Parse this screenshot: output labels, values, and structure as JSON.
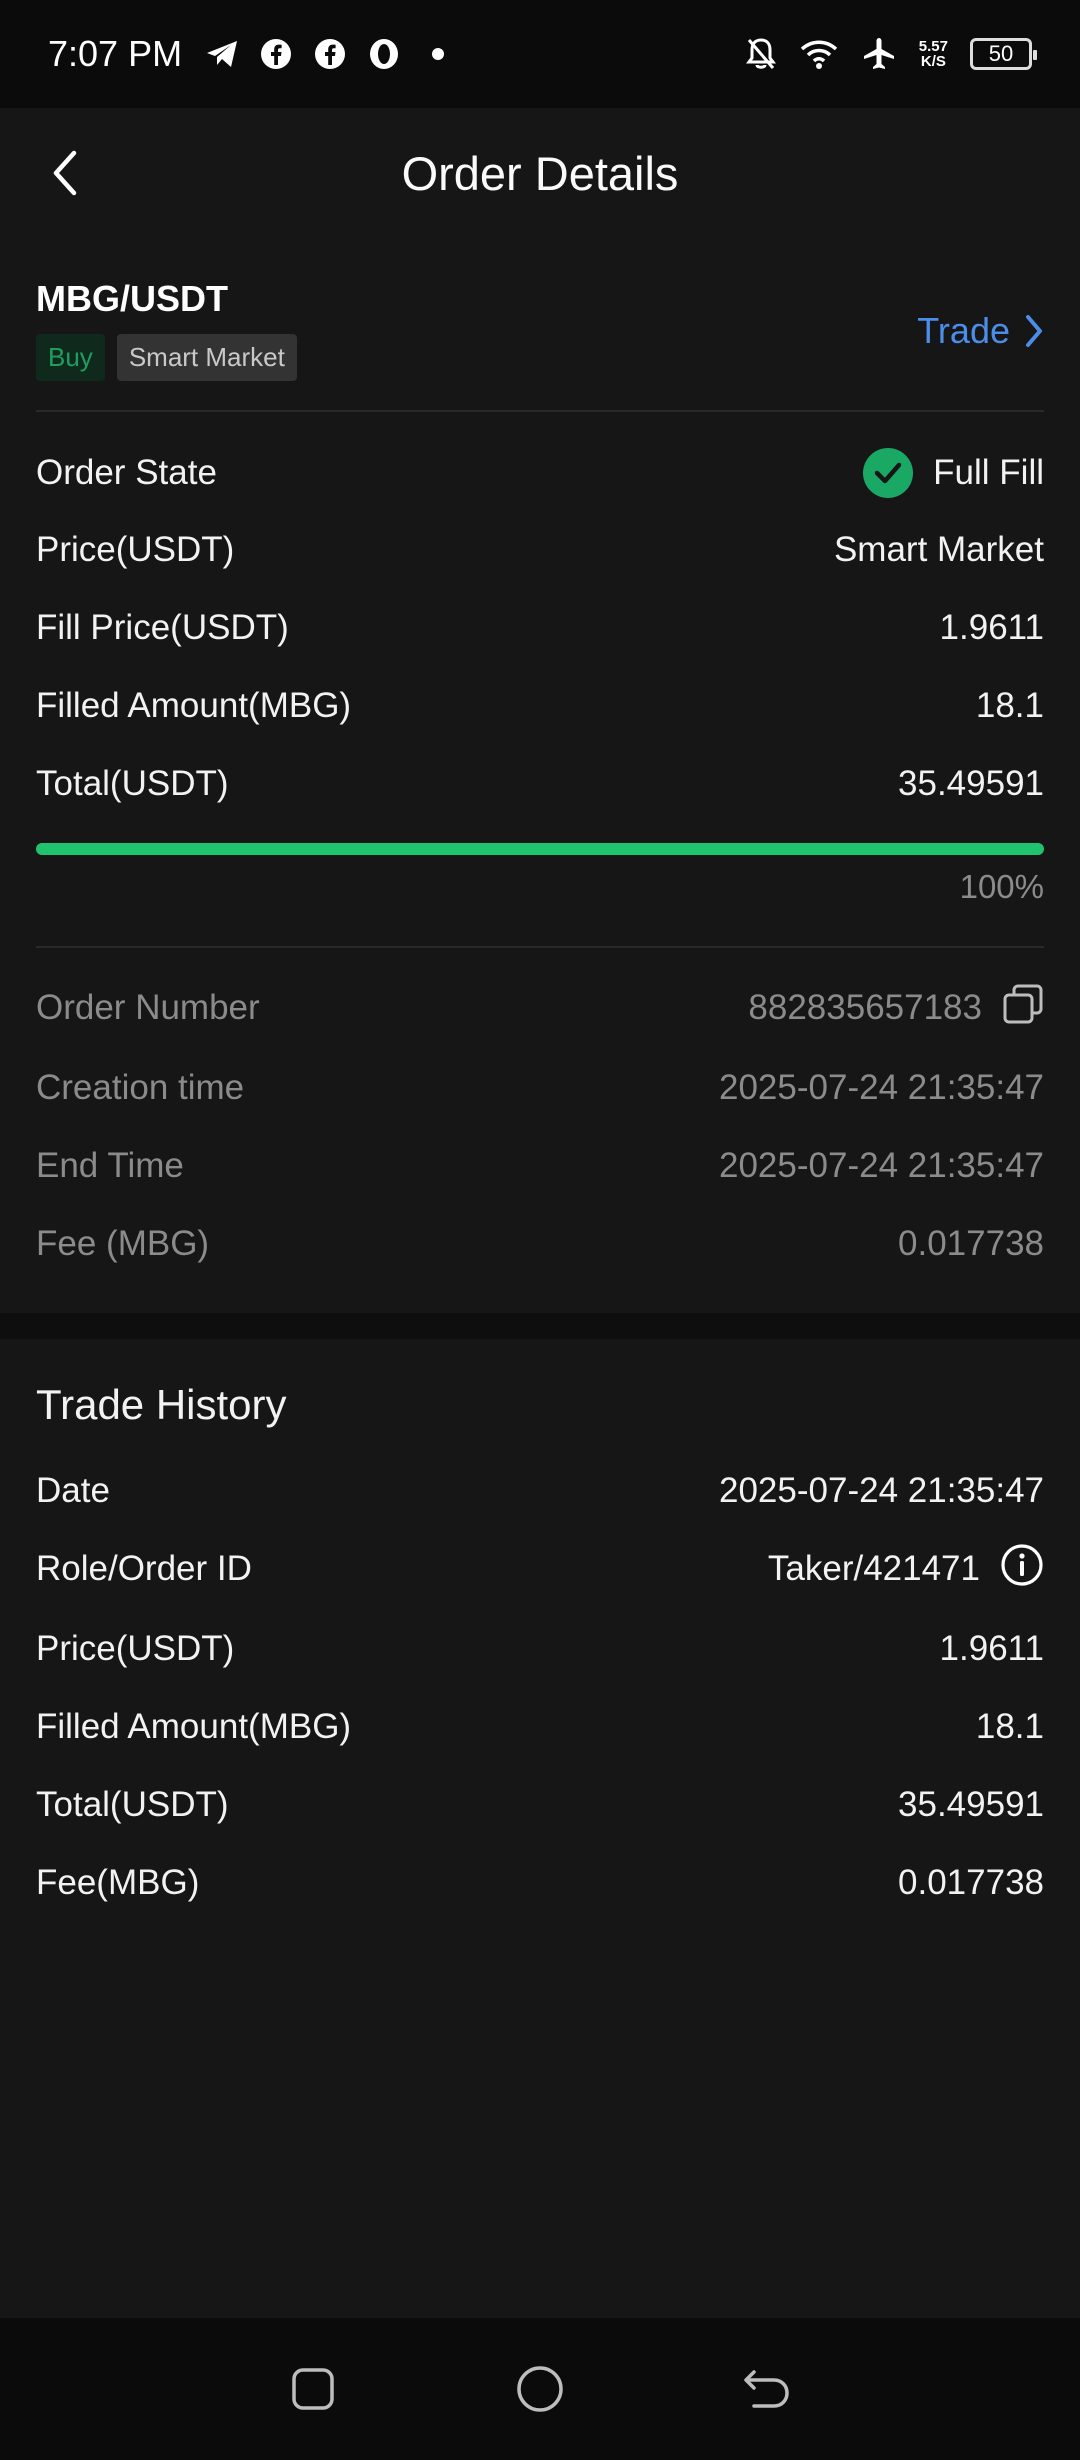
{
  "status_bar": {
    "time": "7:07 PM",
    "net_speed_value": "5.57",
    "net_speed_unit": "K/S",
    "battery": "50"
  },
  "header": {
    "title": "Order Details"
  },
  "order": {
    "pair": "MBG/USDT",
    "side_tag": "Buy",
    "type_tag": "Smart Market",
    "trade_link": "Trade",
    "rows": [
      {
        "label": "Order State",
        "value": "Full Fill"
      },
      {
        "label": "Price(USDT)",
        "value": "Smart Market"
      },
      {
        "label": "Fill Price(USDT)",
        "value": "1.9611"
      },
      {
        "label": "Filled Amount(MBG)",
        "value": "18.1"
      },
      {
        "label": "Total(USDT)",
        "value": "35.49591"
      }
    ],
    "progress_percent": 100,
    "progress_label": "100%",
    "details": [
      {
        "label": "Order Number",
        "value": "882835657183"
      },
      {
        "label": "Creation time",
        "value": "2025-07-24 21:35:47"
      },
      {
        "label": "End Time",
        "value": "2025-07-24 21:35:47"
      },
      {
        "label": "Fee (MBG)",
        "value": "0.017738"
      }
    ]
  },
  "history": {
    "title": "Trade History",
    "rows": [
      {
        "label": "Date",
        "value": "2025-07-24 21:35:47"
      },
      {
        "label": "Role/Order ID",
        "value": "Taker/421471"
      },
      {
        "label": "Price(USDT)",
        "value": "1.9611"
      },
      {
        "label": "Filled Amount(MBG)",
        "value": "18.1"
      },
      {
        "label": "Total(USDT)",
        "value": "35.49591"
      },
      {
        "label": "Fee(MBG)",
        "value": "0.017738"
      }
    ]
  },
  "colors": {
    "accent_blue": "#4b8de8",
    "success_green": "#20c46e",
    "background": "#161616"
  }
}
